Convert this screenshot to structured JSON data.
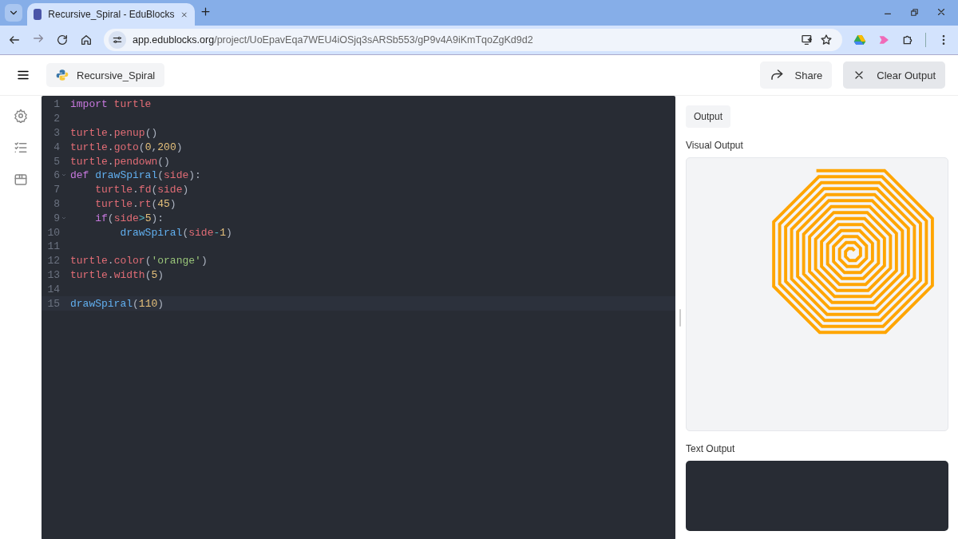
{
  "browser": {
    "tab_title": "Recursive_Spiral - EduBlocks",
    "url_host": "app.edublocks.org",
    "url_path": "/project/UoEpavEqa7WEU4iOSjq3sARSb553/gP9v4A9iKmTqoZgKd9d2"
  },
  "header": {
    "project_name": "Recursive_Spiral",
    "buttons": [
      {
        "kind": "share",
        "label": "Share"
      },
      {
        "kind": "clear",
        "label": "Clear Output"
      }
    ]
  },
  "sidebar": {
    "items": [
      {
        "kind": "settings"
      },
      {
        "kind": "checklist"
      },
      {
        "kind": "package"
      }
    ]
  },
  "editor": {
    "lines": [
      {
        "number": "1",
        "fold": false,
        "active": false,
        "tokens": [
          {
            "kind": "keyword",
            "text": "import"
          },
          {
            "kind": "variable",
            "text": " turtle"
          }
        ]
      },
      {
        "number": "2",
        "fold": false,
        "active": false
      },
      {
        "number": "3",
        "fold": false,
        "active": false,
        "tokens": [
          {
            "kind": "variable",
            "text": "turtle"
          },
          {
            "kind": "punct",
            "text": "."
          },
          {
            "kind": "variable",
            "text": "penup"
          },
          {
            "kind": "punct",
            "text": "()"
          }
        ]
      },
      {
        "number": "4",
        "fold": false,
        "active": false,
        "tokens": [
          {
            "kind": "variable",
            "text": "turtle"
          },
          {
            "kind": "punct",
            "text": "."
          },
          {
            "kind": "variable",
            "text": "goto"
          },
          {
            "kind": "punct",
            "text": "("
          },
          {
            "kind": "number",
            "text": "0"
          },
          {
            "kind": "punct",
            "text": ","
          },
          {
            "kind": "number",
            "text": "200"
          },
          {
            "kind": "punct",
            "text": ")"
          }
        ]
      },
      {
        "number": "5",
        "fold": false,
        "active": false,
        "tokens": [
          {
            "kind": "variable",
            "text": "turtle"
          },
          {
            "kind": "punct",
            "text": "."
          },
          {
            "kind": "variable",
            "text": "pendown"
          },
          {
            "kind": "punct",
            "text": "()"
          }
        ]
      },
      {
        "number": "6",
        "fold": true,
        "active": false,
        "tokens": [
          {
            "kind": "keyword",
            "text": "def"
          },
          {
            "kind": "function",
            "text": " drawSpiral"
          },
          {
            "kind": "punct",
            "text": "("
          },
          {
            "kind": "variable",
            "text": "side"
          },
          {
            "kind": "punct",
            "text": "):"
          }
        ]
      },
      {
        "number": "7",
        "fold": false,
        "active": false,
        "tokens": [
          {
            "kind": "variable",
            "text": "    turtle"
          },
          {
            "kind": "punct",
            "text": "."
          },
          {
            "kind": "variable",
            "text": "fd"
          },
          {
            "kind": "punct",
            "text": "("
          },
          {
            "kind": "variable",
            "text": "side"
          },
          {
            "kind": "punct",
            "text": ")"
          }
        ]
      },
      {
        "number": "8",
        "fold": false,
        "active": false,
        "tokens": [
          {
            "kind": "variable",
            "text": "    turtle"
          },
          {
            "kind": "punct",
            "text": "."
          },
          {
            "kind": "variable",
            "text": "rt"
          },
          {
            "kind": "punct",
            "text": "("
          },
          {
            "kind": "number",
            "text": "45"
          },
          {
            "kind": "punct",
            "text": ")"
          }
        ]
      },
      {
        "number": "9",
        "fold": true,
        "active": false,
        "tokens": [
          {
            "kind": "keyword",
            "text": "    if"
          },
          {
            "kind": "punct",
            "text": "("
          },
          {
            "kind": "variable",
            "text": "side"
          },
          {
            "kind": "operator",
            "text": ">"
          },
          {
            "kind": "number",
            "text": "5"
          },
          {
            "kind": "punct",
            "text": "):"
          }
        ]
      },
      {
        "number": "10",
        "fold": false,
        "active": false,
        "tokens": [
          {
            "kind": "function",
            "text": "        drawSpiral"
          },
          {
            "kind": "punct",
            "text": "("
          },
          {
            "kind": "variable",
            "text": "side"
          },
          {
            "kind": "operator",
            "text": "-"
          },
          {
            "kind": "number",
            "text": "1"
          },
          {
            "kind": "punct",
            "text": ")"
          }
        ]
      },
      {
        "number": "11",
        "fold": false,
        "active": false
      },
      {
        "number": "12",
        "fold": false,
        "active": false,
        "tokens": [
          {
            "kind": "variable",
            "text": "turtle"
          },
          {
            "kind": "punct",
            "text": "."
          },
          {
            "kind": "variable",
            "text": "color"
          },
          {
            "kind": "punct",
            "text": "("
          },
          {
            "kind": "string",
            "text": "'orange'"
          },
          {
            "kind": "punct",
            "text": ")"
          }
        ]
      },
      {
        "number": "13",
        "fold": false,
        "active": false,
        "tokens": [
          {
            "kind": "variable",
            "text": "turtle"
          },
          {
            "kind": "punct",
            "text": "."
          },
          {
            "kind": "variable",
            "text": "width"
          },
          {
            "kind": "punct",
            "text": "("
          },
          {
            "kind": "number",
            "text": "5"
          },
          {
            "kind": "punct",
            "text": ")"
          }
        ]
      },
      {
        "number": "14",
        "fold": false,
        "active": false
      },
      {
        "number": "15",
        "fold": false,
        "active": true,
        "tokens": [
          {
            "kind": "function",
            "text": "drawSpiral"
          },
          {
            "kind": "punct",
            "text": "("
          },
          {
            "kind": "number",
            "text": "110"
          },
          {
            "kind": "punct",
            "text": ")"
          }
        ]
      }
    ]
  },
  "output": {
    "tab": "Output",
    "visual_title": "Visual Output",
    "text_title": "Text Output"
  }
}
